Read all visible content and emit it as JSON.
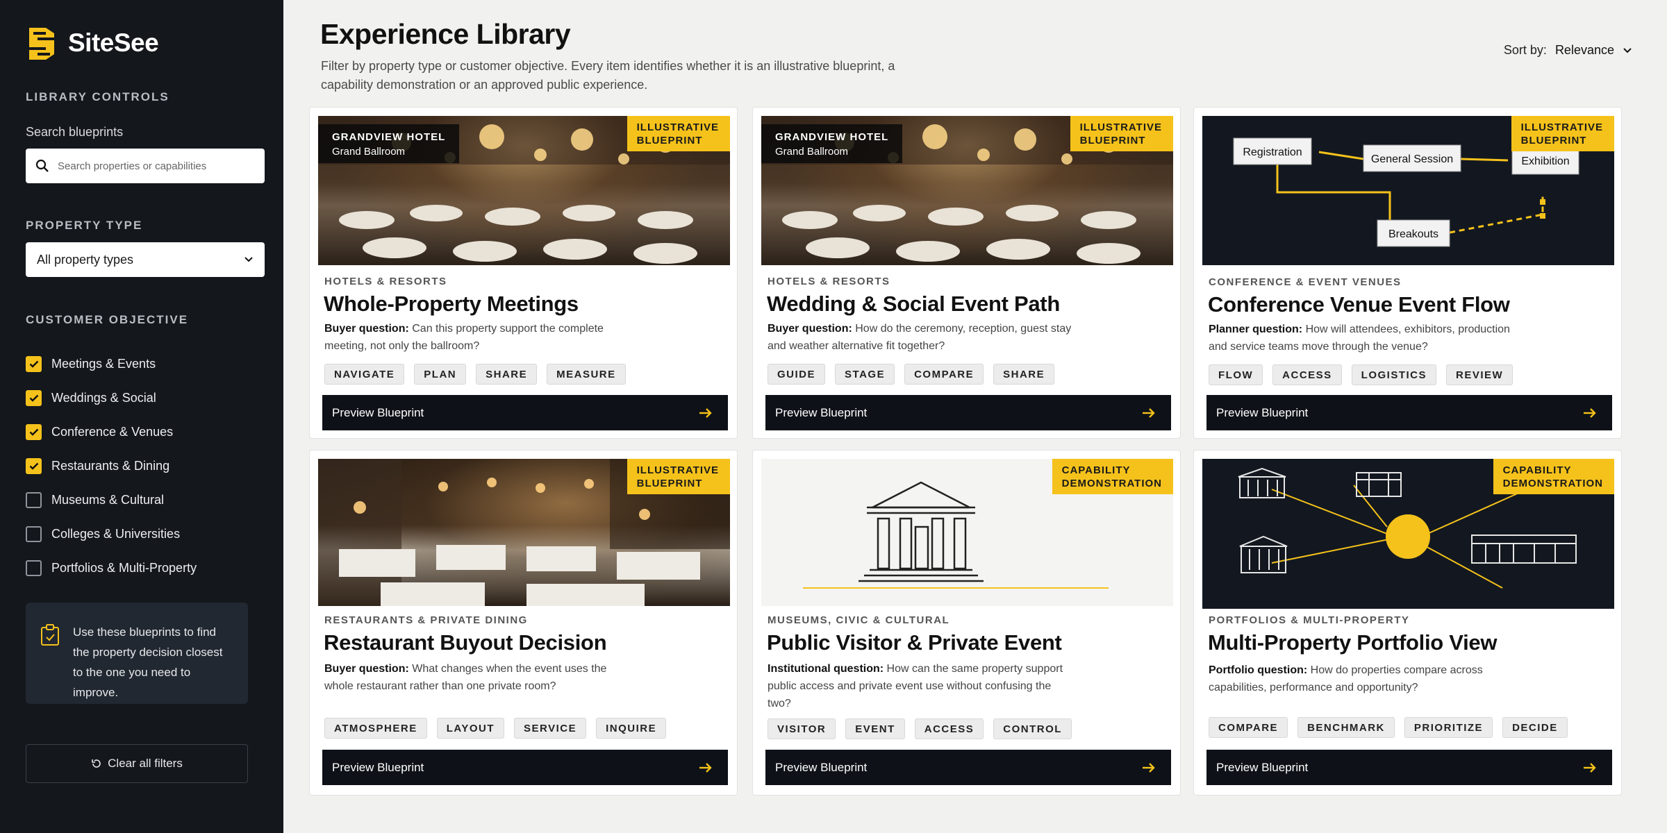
{
  "brand": {
    "name": "SiteSee",
    "accent": "#f5c21b",
    "sidebar_bg": "#14171c"
  },
  "sidebar": {
    "library_controls": "LIBRARY CONTROLS",
    "search_label": "Search blueprints",
    "search_placeholder": "Search properties or capabilities",
    "property_type_title": "PROPERTY TYPE",
    "property_type_value": "All property types",
    "customer_objective_title": "CUSTOMER OBJECTIVE",
    "objectives": [
      {
        "label": "Meetings & Events",
        "checked": true
      },
      {
        "label": "Weddings & Social",
        "checked": true
      },
      {
        "label": "Conference & Venues",
        "checked": true
      },
      {
        "label": "Restaurants & Dining",
        "checked": true
      },
      {
        "label": "Museums & Cultural",
        "checked": false
      },
      {
        "label": "Colleges & Universities",
        "checked": false
      },
      {
        "label": "Portfolios & Multi-Property",
        "checked": false
      }
    ],
    "tip": "Use these blueprints to find the property decision closest to the one you need to improve.",
    "clear_label": "Clear all filters"
  },
  "header": {
    "title": "Experience Library",
    "subtitle": "Filter by property type or customer objective. Every item identifies whether it is an illustrative blueprint, a capability demonstration or an approved public experience.",
    "sort_label": "Sort by:",
    "sort_value": "Relevance"
  },
  "cards": [
    {
      "badge_line1": "ILLUSTRATIVE",
      "badge_line2": "BLUEPRINT",
      "venue_line1": "GRANDVIEW HOTEL",
      "venue_line2": "Grand Ballroom",
      "category": "HOTELS & RESORTS",
      "title": "Whole-Property Meetings",
      "question_label": "Buyer question:",
      "question": "Can this property support the complete meeting, not only the ballroom?",
      "tags": [
        "NAVIGATE",
        "PLAN",
        "SHARE",
        "MEASURE"
      ],
      "cta": "Preview Blueprint"
    },
    {
      "badge_line1": "ILLUSTRATIVE",
      "badge_line2": "BLUEPRINT",
      "venue_line1": "GRANDVIEW HOTEL",
      "venue_line2": "Grand Ballroom",
      "category": "HOTELS & RESORTS",
      "title": "Wedding & Social Event Path",
      "question_label": "Buyer question:",
      "question": "How do the ceremony, reception, guest stay and weather alternative fit together?",
      "tags": [
        "GUIDE",
        "STAGE",
        "COMPARE",
        "SHARE"
      ],
      "cta": "Preview Blueprint"
    },
    {
      "badge_line1": "ILLUSTRATIVE",
      "badge_line2": "BLUEPRINT",
      "flow": {
        "n1": "Registration",
        "n2": "General Session",
        "n3": "Exhibition",
        "n4": "Breakouts"
      },
      "category": "CONFERENCE & EVENT VENUES",
      "title": "Conference Venue Event Flow",
      "question_label": "Planner question:",
      "question": "How will attendees, exhibitors, production and service teams move through the venue?",
      "tags": [
        "FLOW",
        "ACCESS",
        "LOGISTICS",
        "REVIEW"
      ],
      "cta": "Preview Blueprint"
    },
    {
      "badge_line1": "ILLUSTRATIVE",
      "badge_line2": "BLUEPRINT",
      "category": "RESTAURANTS & PRIVATE DINING",
      "title": "Restaurant Buyout Decision",
      "question_label": "Buyer question:",
      "question": "What changes when the event uses the whole restaurant rather than one private room?",
      "tags": [
        "ATMOSPHERE",
        "LAYOUT",
        "SERVICE",
        "INQUIRE"
      ],
      "cta": "Preview Blueprint"
    },
    {
      "badge_line1": "CAPABILITY",
      "badge_line2": "DEMONSTRATION",
      "category": "MUSEUMS, CIVIC & CULTURAL",
      "title": "Public Visitor & Private Event",
      "question_label": "Institutional question:",
      "question": "How can the same property support public access and private event use without confusing the two?",
      "tags": [
        "VISITOR",
        "EVENT",
        "ACCESS",
        "CONTROL"
      ],
      "cta": "Preview Blueprint"
    },
    {
      "badge_line1": "CAPABILITY",
      "badge_line2": "DEMONSTRATION",
      "category": "PORTFOLIOS & MULTI-PROPERTY",
      "title": "Multi-Property Portfolio View",
      "question_label": "Portfolio question:",
      "question": "How do properties compare across capabilities, performance and opportunity?",
      "tags": [
        "COMPARE",
        "BENCHMARK",
        "PRIORITIZE",
        "DECIDE"
      ],
      "cta": "Preview Blueprint"
    }
  ]
}
